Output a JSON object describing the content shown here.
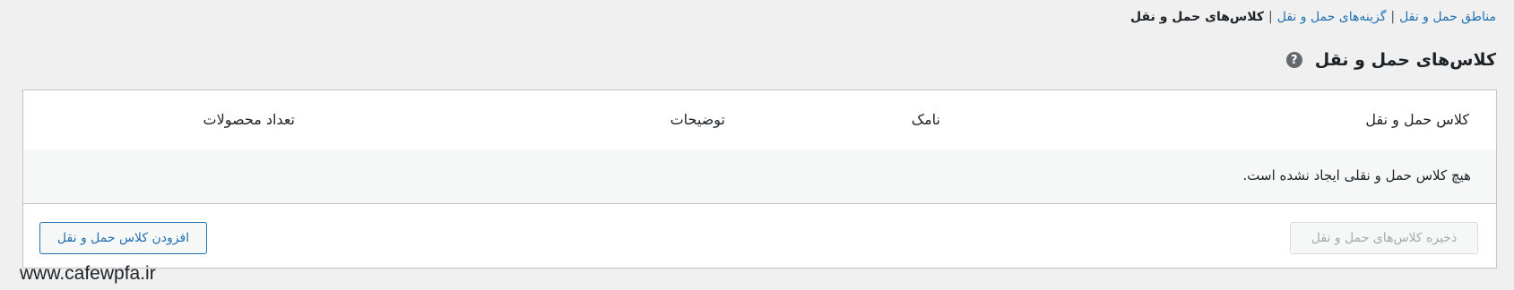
{
  "subnav": {
    "zones": "مناطق حمل و نقل",
    "options": "گزینه‌های حمل و نقل",
    "classes": "کلاس‌های حمل و نقل",
    "separator": "|"
  },
  "heading": {
    "title": "کلاس‌های حمل و نقل",
    "help_icon": "?"
  },
  "table": {
    "columns": {
      "class": "کلاس حمل و نقل",
      "slug": "نامک",
      "description": "توضیحات",
      "count": "تعداد محصولات"
    },
    "empty_message": "هیچ کلاس حمل و نقلی ایجاد نشده است."
  },
  "buttons": {
    "save": "ذخیره کلاس‌های حمل و نقل",
    "add": "افزودن کلاس حمل و نقل"
  },
  "watermark": "www.cafewpfa.ir",
  "colors": {
    "link": "#2271b1",
    "background": "#f0f0f1",
    "border": "#c3c4c7"
  }
}
